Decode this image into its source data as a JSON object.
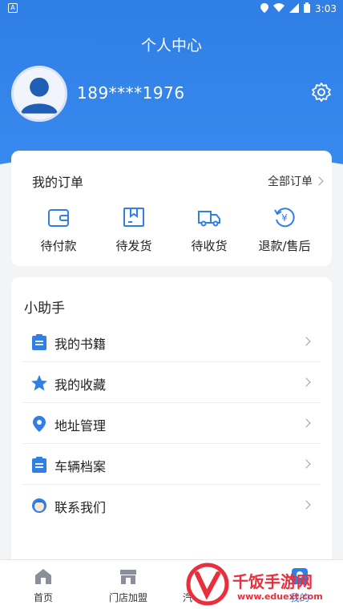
{
  "status_bar": {
    "time": "3:03"
  },
  "header": {
    "title": "个人中心",
    "phone": "189****1976"
  },
  "orders": {
    "title": "我的订单",
    "all_label": "全部订单",
    "items": [
      {
        "label": "待付款",
        "icon": "wallet-icon"
      },
      {
        "label": "待发货",
        "icon": "package-icon"
      },
      {
        "label": "待收货",
        "icon": "truck-icon"
      },
      {
        "label": "退款/售后",
        "icon": "refund-icon"
      }
    ]
  },
  "helper": {
    "title": "小助手",
    "items": [
      {
        "label": "我的书籍",
        "icon": "clipboard-icon"
      },
      {
        "label": "我的收藏",
        "icon": "star-icon"
      },
      {
        "label": "地址管理",
        "icon": "location-pin-icon"
      },
      {
        "label": "车辆档案",
        "icon": "clipboard-icon"
      },
      {
        "label": "联系我们",
        "icon": "support-agent-icon"
      }
    ]
  },
  "tabbar": {
    "items": [
      {
        "label": "首页",
        "icon": "home-icon"
      },
      {
        "label": "门店加盟",
        "icon": "store-icon"
      },
      {
        "label": "汽",
        "icon": ""
      },
      {
        "label": "我的",
        "icon": "user-icon"
      }
    ]
  },
  "watermark": {
    "text": "千饭手游网",
    "url": "www.eduext.com"
  },
  "colors": {
    "primary": "#2f7fe6",
    "watermark": "#e8303c"
  }
}
